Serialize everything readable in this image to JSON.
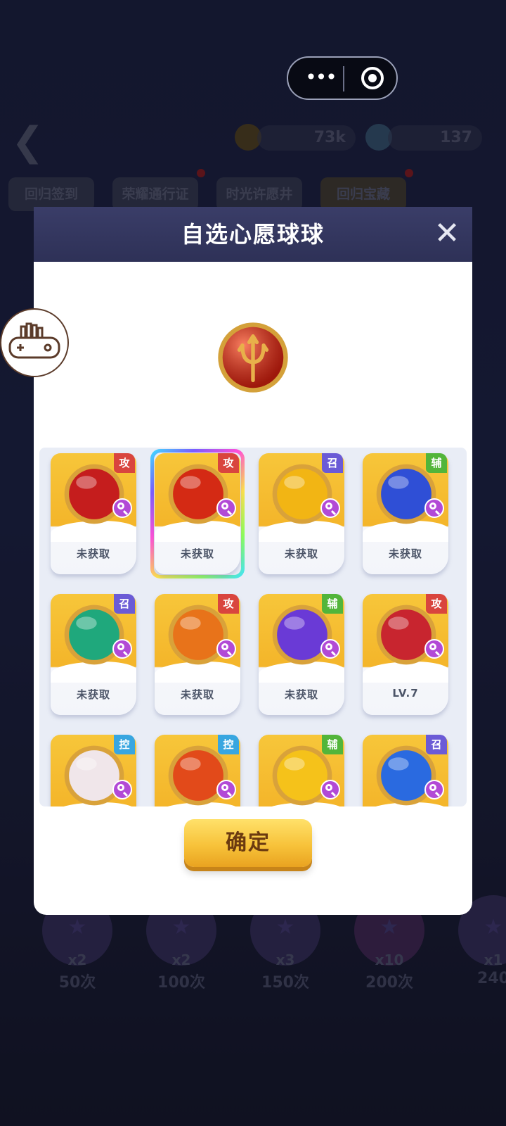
{
  "capsule": {
    "more_icon": "more-dots-icon",
    "close_icon": "target-circle-icon"
  },
  "background": {
    "coins": "73k",
    "gems": "137",
    "tabs": [
      "回归签到",
      "荣耀通行证",
      "时光许愿井",
      "回归宝藏"
    ]
  },
  "modal": {
    "title": "自选心愿球球",
    "confirm_label": "确定",
    "cards": [
      {
        "tag": "攻",
        "tag_color": "#d9453e",
        "label": "未获取",
        "ball": "venom-ball",
        "ball_color": "#c51d1d",
        "selected": false
      },
      {
        "tag": "攻",
        "tag_color": "#d9453e",
        "label": "未获取",
        "ball": "trident-ball",
        "ball_color": "#d42a14",
        "selected": true
      },
      {
        "tag": "召",
        "tag_color": "#6b5bd6",
        "label": "未获取",
        "ball": "golden-hand-ball",
        "ball_color": "#f2b514",
        "selected": false
      },
      {
        "tag": "辅",
        "tag_color": "#52b53a",
        "label": "未获取",
        "ball": "hex-shield-ball",
        "ball_color": "#2f4fd6",
        "selected": false
      },
      {
        "tag": "召",
        "tag_color": "#6b5bd6",
        "label": "未获取",
        "ball": "swirl-ball",
        "ball_color": "#1fa87c",
        "selected": false
      },
      {
        "tag": "攻",
        "tag_color": "#d9453e",
        "label": "未获取",
        "ball": "phoenix-ball",
        "ball_color": "#e8731a",
        "selected": false
      },
      {
        "tag": "辅",
        "tag_color": "#52b53a",
        "label": "未获取",
        "ball": "lightning-ball",
        "ball_color": "#6a3ad6",
        "selected": false
      },
      {
        "tag": "攻",
        "tag_color": "#d9453e",
        "label": "LV.7",
        "ball": "opera-mask-ball",
        "ball_color": "#c8252f",
        "selected": false
      },
      {
        "tag": "控",
        "tag_color": "#38a6e0",
        "label": "",
        "ball": "ram-horn-ball",
        "ball_color": "#f0e6ea",
        "selected": false
      },
      {
        "tag": "控",
        "tag_color": "#38a6e0",
        "label": "",
        "ball": "starburst-ball",
        "ball_color": "#e24a1a",
        "selected": false
      },
      {
        "tag": "辅",
        "tag_color": "#52b53a",
        "label": "",
        "ball": "sun-ball",
        "ball_color": "#f5c21a",
        "selected": false
      },
      {
        "tag": "召",
        "tag_color": "#6b5bd6",
        "label": "",
        "ball": "potion-ball",
        "ball_color": "#2a6ae0",
        "selected": false
      }
    ]
  },
  "rewards": [
    {
      "count": "x2",
      "times": "50次"
    },
    {
      "count": "x2",
      "times": "100次"
    },
    {
      "count": "x3",
      "times": "150次"
    },
    {
      "count": "x10",
      "times": "200次"
    },
    {
      "count": "x1",
      "times": "240"
    }
  ]
}
